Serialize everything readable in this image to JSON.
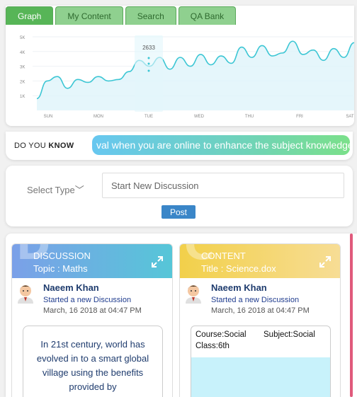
{
  "tabs": [
    {
      "label": "Graph",
      "active": true
    },
    {
      "label": "My Content",
      "active": false
    },
    {
      "label": "Search",
      "active": false
    },
    {
      "label": "QA Bank",
      "active": false
    }
  ],
  "chart_data": {
    "type": "area",
    "x": [
      "SUN",
      "MON",
      "TUE",
      "WED",
      "THU",
      "FRI",
      "SAT"
    ],
    "y_ticks": [
      "1K",
      "2K",
      "3K",
      "4K",
      "5K"
    ],
    "ylim": [
      0,
      5000
    ],
    "tooltip": {
      "label": "2633",
      "x": "TUE"
    },
    "series": [
      {
        "values": [
          800,
          2000,
          2300,
          1500,
          2100,
          1900,
          2300,
          2000,
          2100,
          2633,
          3400,
          3000,
          3600,
          2800,
          3600,
          3000,
          3800,
          3100,
          3700,
          3200,
          4300,
          3600,
          4400,
          3700,
          3900,
          4700,
          3800,
          4100,
          3400,
          4200,
          3600,
          4600
        ]
      }
    ],
    "colors": {
      "line": "#3cc6d4",
      "fill": "#def4fa"
    }
  },
  "dyk": {
    "label_plain": "DO YOU ",
    "label_bold": "KNOW",
    "ticker": "val when you are online to enhance the subject knowledge"
  },
  "composer": {
    "select_type": "Select Type",
    "placeholder": "Start New Discussion",
    "post_label": "Post"
  },
  "cards": [
    {
      "big_letter": "D",
      "header_line1": "DISCUSSION",
      "header_line2": "Topic : Maths",
      "author": "Naeem Khan",
      "action": "Started a new Discussion",
      "date": "March, 16 2018 at 04:47 PM",
      "body": "In 21st century, world has evolved in to a smart global village using the benefits provided by"
    },
    {
      "big_letter": "C",
      "header_line1": "CONTENT",
      "header_line2": "Title : Science.dox",
      "author": "Naeem Khan",
      "action": "Started a new Discussion",
      "date": "March, 16 2018 at 04:47 PM",
      "course": "Course:Social",
      "subject": "Subject:Social",
      "class": "Class:6th"
    }
  ]
}
